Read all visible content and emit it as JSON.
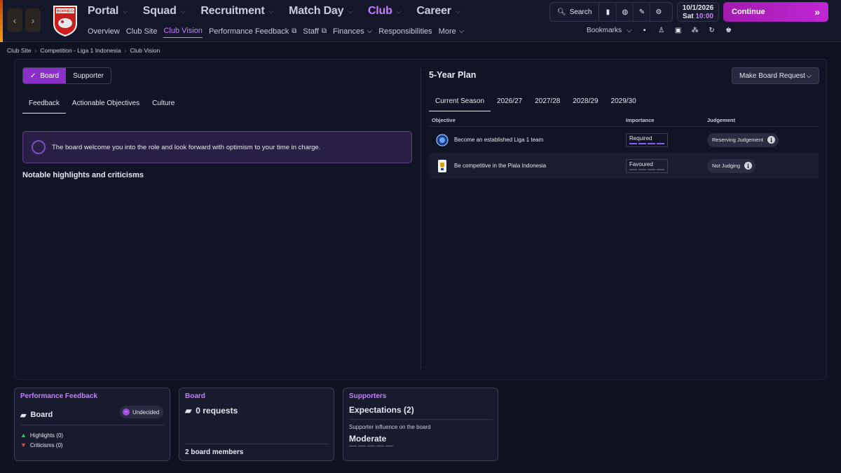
{
  "topbar": {
    "back_icon": "chevron-left-icon",
    "forward_icon": "chevron-right-icon",
    "club_logo_text": "BORNEO",
    "main_nav": [
      {
        "label": "Portal",
        "active": false
      },
      {
        "label": "Squad",
        "active": false
      },
      {
        "label": "Recruitment",
        "active": false
      },
      {
        "label": "Match Day",
        "active": false
      },
      {
        "label": "Club",
        "active": true
      },
      {
        "label": "Career",
        "active": false
      }
    ],
    "sub_nav": [
      {
        "label": "Overview"
      },
      {
        "label": "Club Site"
      },
      {
        "label": "Club Vision"
      },
      {
        "label": "Performance Feedback"
      },
      {
        "label": "Staff"
      },
      {
        "label": "Finances"
      },
      {
        "label": "Responsibilities"
      },
      {
        "label": "More"
      }
    ],
    "search_label": "Search",
    "date": "10/1/2026",
    "day": "Sat",
    "time": "10:00",
    "continue_label": "Continue",
    "bookmarks_label": "Bookmarks"
  },
  "breadcrumb": [
    "Club Site",
    "Competition - Liga 1 Indonesia",
    "Club Vision"
  ],
  "left_panel": {
    "toggle_board": "Board",
    "toggle_supporter": "Supporter",
    "tabs": [
      "Feedback",
      "Actionable Objectives",
      "Culture"
    ],
    "message": "The board welcome you into the role and look forward with optimism to your time in charge.",
    "highlights_title": "Notable highlights and criticisms"
  },
  "plan": {
    "title": "5-Year Plan",
    "request_button": "Make Board Request",
    "seasons": [
      "Current Season",
      "2026/27",
      "2027/28",
      "2028/29",
      "2029/30"
    ],
    "headers": {
      "objective": "Objective",
      "importance": "Importance",
      "judgement": "Judgement"
    },
    "rows": [
      {
        "objective": "Become an established Liga 1 team",
        "importance": "Required",
        "importance_level": 4,
        "judgement": "Reserving Judgement"
      },
      {
        "objective": "Be competitive in the Piala Indonesia",
        "importance": "Favoured",
        "importance_level": 0,
        "judgement": "Not Judging"
      }
    ]
  },
  "cards": {
    "performance": {
      "title": "Performance Feedback",
      "board_label": "Board",
      "status": "Undecided",
      "highlights": "Highlights (0)",
      "criticisms": "Criticisms (0)"
    },
    "board": {
      "title": "Board",
      "requests": "0 requests",
      "members": "2 board members"
    },
    "supporters": {
      "title": "Supporters",
      "expectations": "Expectations (2)",
      "influence_label": "Supporter influence on the board",
      "influence_value": "Moderate"
    }
  },
  "colors": {
    "accent": "#c77dff",
    "continue": "#c026d3",
    "background": "#0f1220"
  }
}
